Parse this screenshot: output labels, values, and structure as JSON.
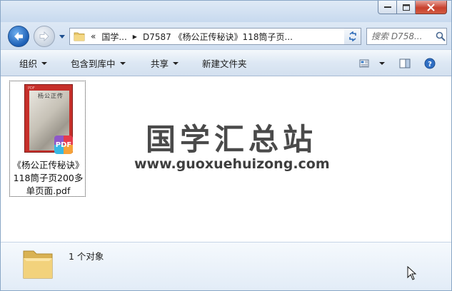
{
  "window": {
    "caption_buttons": [
      "minimize",
      "maximize",
      "close"
    ]
  },
  "navigation": {
    "back_icon": "arrow-left-icon",
    "forward_icon": "arrow-right-icon",
    "address": {
      "overflow": "«",
      "crumbs": [
        "国学...",
        "D7587 《杨公正传秘诀》118筒子页..."
      ]
    },
    "search_placeholder": "搜索 D758..."
  },
  "toolbar": {
    "organize": "组织",
    "include_in_library": "包含到库中",
    "share": "共享",
    "new_folder": "新建文件夹"
  },
  "files": [
    {
      "name": "《杨公正传秘诀》118筒子页200多单页面.pdf",
      "thumb_header": "PDF",
      "thumb_title": "杨公正传",
      "badge": "PDF"
    }
  ],
  "watermark": {
    "name": "国学汇总站",
    "url": "www.guoxuehuizong.com"
  },
  "details": {
    "status": "1 个对象"
  },
  "colors": {
    "accent": "#1d5fb5",
    "close_button": "#c8412e",
    "thumb_cover": "#c62f2a"
  }
}
